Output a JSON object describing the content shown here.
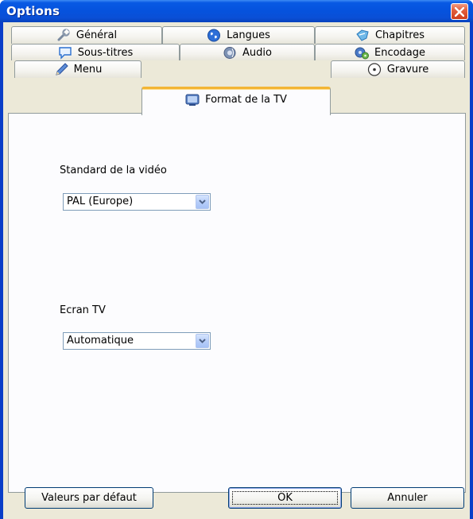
{
  "window": {
    "title": "Options"
  },
  "tabs": {
    "row1": [
      {
        "label": "Général",
        "icon": "wrench-icon"
      },
      {
        "label": "Langues",
        "icon": "globe-icon"
      },
      {
        "label": "Chapitres",
        "icon": "bookmark-icon"
      }
    ],
    "row2": [
      {
        "label": "Sous-titres",
        "icon": "speech-bubble-icon"
      },
      {
        "label": "Audio",
        "icon": "speaker-icon"
      },
      {
        "label": "Encodage",
        "icon": "gears-icon"
      }
    ],
    "row3": [
      {
        "label": "Menu",
        "icon": "pencil-icon"
      },
      {
        "label": "Format de la TV",
        "icon": "tv-icon",
        "active": true
      },
      {
        "label": "Gravure",
        "icon": "disc-icon"
      }
    ]
  },
  "panel": {
    "video_standard": {
      "label": "Standard de la vidéo",
      "value": "PAL (Europe)"
    },
    "tv_screen": {
      "label": "Ecran TV",
      "value": "Automatique"
    }
  },
  "buttons": {
    "defaults": "Valeurs par défaut",
    "ok": "OK",
    "cancel": "Annuler"
  },
  "colors": {
    "titlebar": "#0553de",
    "close": "#e2603e",
    "face": "#ece9d8",
    "active_tab_accent": "#f3b535"
  }
}
